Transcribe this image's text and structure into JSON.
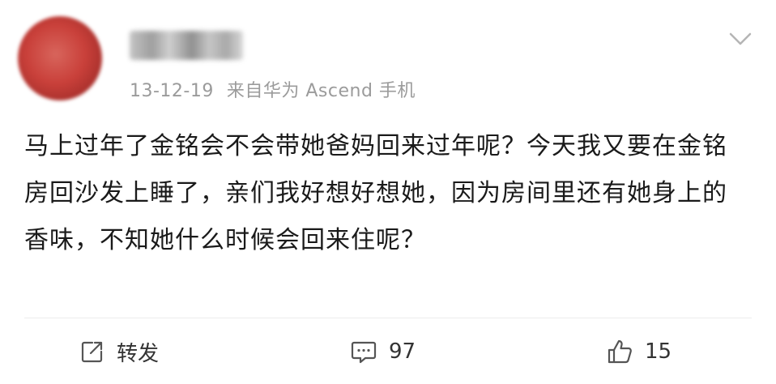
{
  "post": {
    "date": "13-12-19",
    "source": "来自华为 Ascend 手机",
    "content": "马上过年了金铭会不会带她爸妈回来过年呢？今天我又要在金铭房回沙发上睡了，亲们我好想好想她，因为房间里还有她身上的香味，不知她什么时候会回来住呢？"
  },
  "actions": {
    "forward_label": "转发",
    "comment_count": "97",
    "like_count": "15"
  },
  "icons": {
    "menu": "chevron-down-icon",
    "forward": "share-icon",
    "comment": "comment-icon",
    "like": "thumbs-up-icon"
  },
  "colors": {
    "text": "#1a1a1a",
    "meta": "#9b9b9b",
    "icon": "#555555"
  }
}
